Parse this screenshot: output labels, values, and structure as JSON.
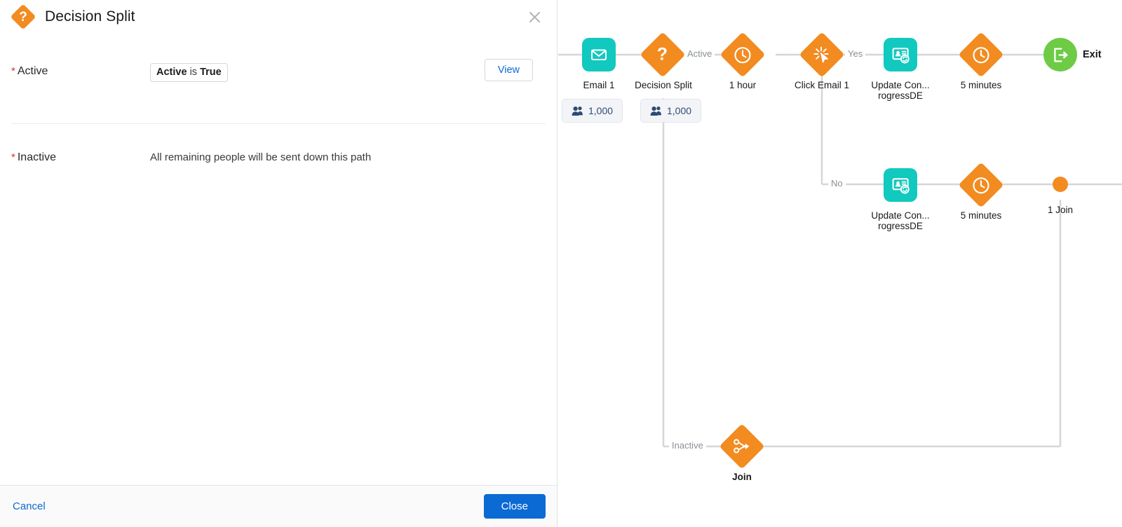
{
  "panel": {
    "icon": "decision-split-diamond-icon",
    "icon_glyph": "?",
    "title": "Decision Split",
    "close_icon": "close-icon",
    "fields": [
      {
        "label": "Active",
        "required_marker": "*",
        "chip": {
          "attribute": "Active",
          "operator": "is",
          "value": "True"
        },
        "action_label": "View"
      },
      {
        "label": "Inactive",
        "required_marker": "*",
        "description": "All remaining people will be sent down this path"
      }
    ],
    "footer": {
      "cancel_label": "Cancel",
      "close_label": "Close"
    }
  },
  "canvas": {
    "nodes": [
      {
        "id": "email1",
        "label": "Email 1",
        "icon": "envelope-icon",
        "shape": "square",
        "color": "#11c9be"
      },
      {
        "id": "decision",
        "label": "Decision Split",
        "icon": "question-mark-icon",
        "shape": "diamond",
        "color": "#f28b20"
      },
      {
        "id": "wait1",
        "label": "1 hour",
        "icon": "clock-icon",
        "shape": "diamond",
        "color": "#f28b20"
      },
      {
        "id": "click1",
        "label": "Click Email 1",
        "icon": "click-burst-icon",
        "shape": "diamond",
        "color": "#f28b20"
      },
      {
        "id": "update1",
        "label": "Update Con...",
        "label2": "rogressDE",
        "icon": "update-contact-icon",
        "shape": "square",
        "color": "#11c9be"
      },
      {
        "id": "wait2",
        "label": "5 minutes",
        "icon": "clock-icon",
        "shape": "diamond",
        "color": "#f28b20"
      },
      {
        "id": "exit",
        "label": "Exit",
        "icon": "exit-door-icon",
        "shape": "circle",
        "color": "#6ecb46"
      },
      {
        "id": "update2",
        "label": "Update Con...",
        "label2": "rogressDE",
        "icon": "update-contact-icon",
        "shape": "square",
        "color": "#11c9be"
      },
      {
        "id": "wait3",
        "label": "5 minutes",
        "icon": "clock-icon",
        "shape": "diamond",
        "color": "#f28b20"
      },
      {
        "id": "join1",
        "label": "1 Join",
        "icon": "join-dot-icon",
        "shape": "dot",
        "color": "#f28b20"
      },
      {
        "id": "join2",
        "label": "Join",
        "icon": "join-arrow-icon",
        "shape": "diamond",
        "color": "#f28b20"
      }
    ],
    "edge_labels": [
      {
        "id": "active",
        "text": "Active"
      },
      {
        "id": "yes",
        "text": "Yes"
      },
      {
        "id": "no",
        "text": "No"
      },
      {
        "id": "inactive",
        "text": "Inactive"
      }
    ],
    "count_pills": [
      {
        "id": "email1-count",
        "icon": "people-icon",
        "value": "1,000"
      },
      {
        "id": "decision-count",
        "icon": "people-icon",
        "value": "1,000"
      }
    ],
    "wire_color": "#d4d6d8"
  }
}
